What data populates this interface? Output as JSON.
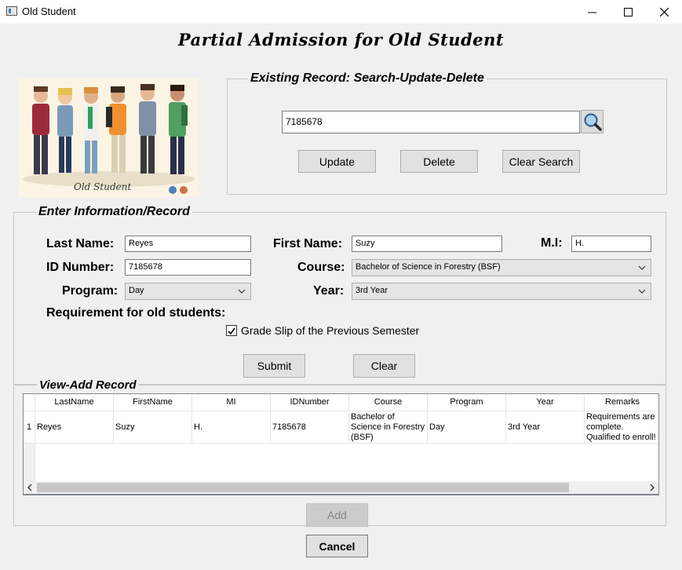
{
  "window": {
    "title": "Old Student"
  },
  "page": {
    "title": "Partial Admission for Old Student"
  },
  "illustration": {
    "caption": "Old Student"
  },
  "search": {
    "legend": "Existing Record: Search-Update-Delete",
    "value": "7185678",
    "update_label": "Update",
    "delete_label": "Delete",
    "clear_label": "Clear Search"
  },
  "form": {
    "legend": "Enter Information/Record",
    "last_name_label": "Last Name:",
    "last_name_value": "Reyes",
    "first_name_label": "First Name:",
    "first_name_value": "Suzy",
    "mi_label": "M.I:",
    "mi_value": "H.",
    "id_label": "ID Number:",
    "id_value": "7185678",
    "course_label": "Course:",
    "course_value": "Bachelor of Science in Forestry (BSF)",
    "program_label": "Program:",
    "program_value": "Day",
    "year_label": "Year:",
    "year_value": "3rd Year",
    "requirement_label": "Requirement for old students:",
    "requirement_checkbox_label": "Grade Slip of the Previous Semester",
    "requirement_checked": true,
    "submit_label": "Submit",
    "clear_label": "Clear"
  },
  "records": {
    "legend": "View-Add Record",
    "columns": [
      "LastName",
      "FirstName",
      "MI",
      "IDNumber",
      "Course",
      "Program",
      "Year",
      "Remarks"
    ],
    "rows": [
      {
        "num": "1",
        "cells": [
          "Reyes",
          "Suzy",
          "H.",
          "7185678",
          "Bachelor of Science in Forestry (BSF)",
          "Day",
          "3rd Year",
          "Requirements are complete. Qualified to enroll!"
        ]
      }
    ],
    "add_label": "Add"
  },
  "footer": {
    "cancel_label": "Cancel"
  }
}
